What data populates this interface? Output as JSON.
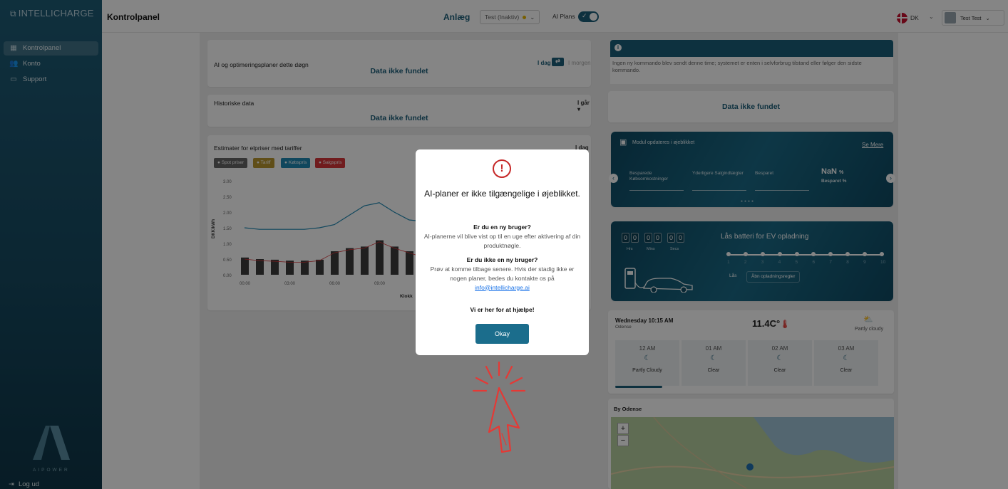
{
  "sidebar": {
    "brand": "INTELLICHARGE",
    "items": [
      {
        "label": "Kontrolpanel",
        "icon": "grid-icon"
      },
      {
        "label": "Konto",
        "icon": "users-icon"
      },
      {
        "label": "Support",
        "icon": "support-card-icon"
      }
    ],
    "logo_text": "AIPOWER",
    "logout": "Log ud"
  },
  "header": {
    "title": "Kontrolpanel",
    "anlaeg_label": "Anlæg",
    "anlaeg_value": "Test (Inaktiv)",
    "ai_plans_label": "AI Plans",
    "language": "DK",
    "user": "Test Test"
  },
  "cards": {
    "ai_plans": {
      "title": "AI og optimeringsplaner dette døgn",
      "today": "I dag",
      "tomorrow": "I morgen",
      "empty": "Data ikke fundet"
    },
    "history": {
      "title": "Historiske data",
      "period": "I går ▾",
      "empty": "Data ikke fundet"
    },
    "estimates": {
      "title": "Estimater for elpriser med tariffer",
      "period": "I dag ▾",
      "chips": [
        "Spot priser",
        "Tariff",
        "Købspris",
        "Salgspris"
      ],
      "ylabel": "DKK/kWh",
      "xlabel": "Klokk"
    },
    "info": {
      "text": "Ingen ny kommando blev sendt denne time; systemet er enten i selvforbrug tilstand eller følger den sidste kommando."
    },
    "no_data_right": {
      "empty": "Data ikke fundet"
    },
    "module": {
      "title": "Modul opdateres i øjeblikket",
      "see_more": "Se Mere",
      "stats": [
        "Besparede Købsomkostninger",
        "Yderligere Salgindtægter",
        "Besparet"
      ],
      "nan_value": "NaN",
      "nan_unit": "%",
      "nan_label": "Besparet %"
    },
    "ev": {
      "digits": [
        "0",
        "0",
        "0",
        "0",
        "0",
        "0"
      ],
      "time_labels": [
        "Hrs",
        "Mins",
        "Secs"
      ],
      "title": "Lås batteri for EV opladning",
      "slider_numbers": [
        "1",
        "2",
        "3",
        "4",
        "5",
        "6",
        "7",
        "8",
        "9",
        "10"
      ],
      "lock_button": "Lås",
      "rules_button": "Åbn opladningsregler"
    },
    "weather": {
      "day": "Wednesday 10:15 AM",
      "city": "Odense",
      "temp": "11.4C°",
      "condition": "Partly cloudy",
      "hours": [
        {
          "time": "12 AM",
          "cond": "Partly Cloudy"
        },
        {
          "time": "01 AM",
          "cond": "Clear"
        },
        {
          "time": "02 AM",
          "cond": "Clear"
        },
        {
          "time": "03 AM",
          "cond": "Clear"
        }
      ]
    },
    "map": {
      "title": "By Odense",
      "zoom_in": "+",
      "zoom_out": "−"
    }
  },
  "chart_data": {
    "type": "bar",
    "yticks": [
      "3.00",
      "2.50",
      "2.00",
      "1.50",
      "1.00",
      "0.50",
      "0.00"
    ],
    "xticks": [
      "00:00",
      "03:00",
      "06:00",
      "09:00",
      "1"
    ],
    "ylim": [
      0,
      3
    ],
    "series": [
      {
        "name": "Spot priser",
        "type": "bar",
        "values": [
          0.55,
          0.5,
          0.48,
          0.45,
          0.45,
          0.48,
          0.75,
          0.85,
          0.9,
          1.1,
          0.9,
          0.75,
          0.6,
          0.45
        ]
      },
      {
        "name": "Købspris",
        "type": "line",
        "values": [
          1.5,
          1.45,
          1.45,
          1.45,
          1.45,
          1.5,
          1.6,
          1.9,
          2.2,
          2.3,
          2.0,
          1.75,
          1.7,
          1.65
        ]
      },
      {
        "name": "Salgspris",
        "type": "line",
        "values": [
          0.5,
          0.45,
          0.43,
          0.4,
          0.4,
          0.45,
          0.7,
          0.8,
          0.85,
          1.05,
          0.85,
          0.7,
          0.55,
          0.4
        ]
      }
    ]
  },
  "modal": {
    "title": "AI-planer er ikke tilgængelige i øjeblikket.",
    "q1": "Er du en ny bruger?",
    "t1": "AI-planerne vil blive vist op til en uge efter aktivering af din produktnøgle.",
    "q2": "Er du ikke en ny bruger?",
    "t2": "Prøv at komme tilbage senere. Hvis der stadig ikke er nogen planer, bedes du kontakte os på",
    "email": "info@intellicharge.ai",
    "help": "Vi er her for at hjælpe!",
    "button": "Okay"
  },
  "colors": {
    "primary": "#1b5e7a",
    "spot": "#666666",
    "tariff": "#b8962e",
    "buy": "#1f88b3",
    "sell": "#d6363a",
    "alert": "#c62828"
  }
}
